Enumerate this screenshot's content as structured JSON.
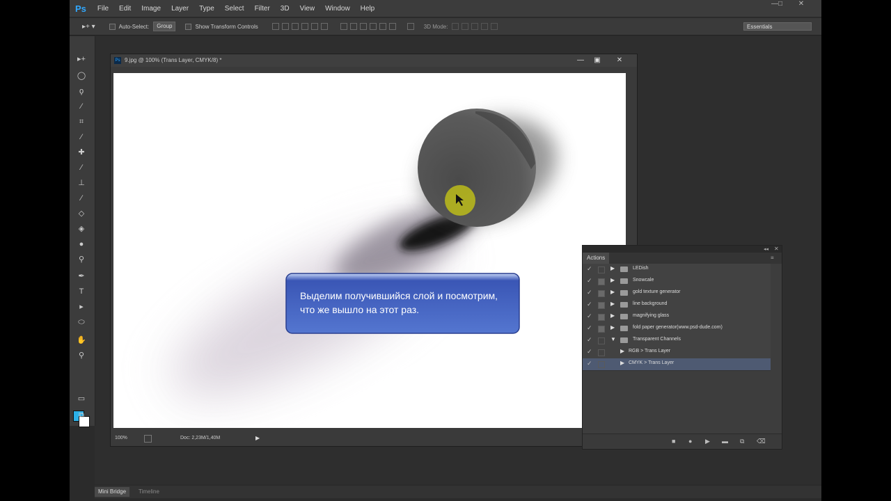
{
  "menubar": {
    "logo": "Ps",
    "items": [
      "File",
      "Edit",
      "Image",
      "Layer",
      "Type",
      "Select",
      "Filter",
      "3D",
      "View",
      "Window",
      "Help"
    ]
  },
  "optionsbar": {
    "auto_select_label": "Auto-Select:",
    "auto_select_value": "Group",
    "show_transform_label": "Show Transform Controls",
    "mode_3d_label": "3D Mode:",
    "workspace": "Essentials"
  },
  "document": {
    "title": "9.jpg @ 100% (Trans Layer, CMYK/8) *",
    "zoom": "100%",
    "doc_info": "Doc: 2,23M/1,40M"
  },
  "caption": {
    "text": "Выделим получившийся слой и посмотрим, что же вышло на этот раз."
  },
  "actions_panel": {
    "title": "Actions",
    "rows": [
      {
        "label": "LEDish",
        "expanded": false,
        "indent": 0,
        "type": "set",
        "selected": false
      },
      {
        "label": "Snowcale",
        "expanded": false,
        "indent": 0,
        "type": "set",
        "selected": false
      },
      {
        "label": "gold texture generator",
        "expanded": false,
        "indent": 0,
        "type": "set",
        "selected": false
      },
      {
        "label": "line background",
        "expanded": false,
        "indent": 0,
        "type": "set",
        "selected": false
      },
      {
        "label": "magnifying glass",
        "expanded": false,
        "indent": 0,
        "type": "set",
        "selected": false
      },
      {
        "label": "fold paper generator(www.psd-dude.com)",
        "expanded": false,
        "indent": 0,
        "type": "set",
        "selected": false
      },
      {
        "label": "Transparent Channels",
        "expanded": true,
        "indent": 0,
        "type": "set",
        "selected": false
      },
      {
        "label": "RGB > Trans Layer",
        "expanded": false,
        "indent": 1,
        "type": "action",
        "selected": false
      },
      {
        "label": "CMYK > Trans Layer",
        "expanded": false,
        "indent": 1,
        "type": "action",
        "selected": true
      }
    ]
  },
  "bottom_tabs": [
    "Mini Bridge",
    "Timeline"
  ],
  "colors": {
    "foreground": "#2bb0e8",
    "background": "#ffffff",
    "caption_box": "#3e5fbf"
  }
}
